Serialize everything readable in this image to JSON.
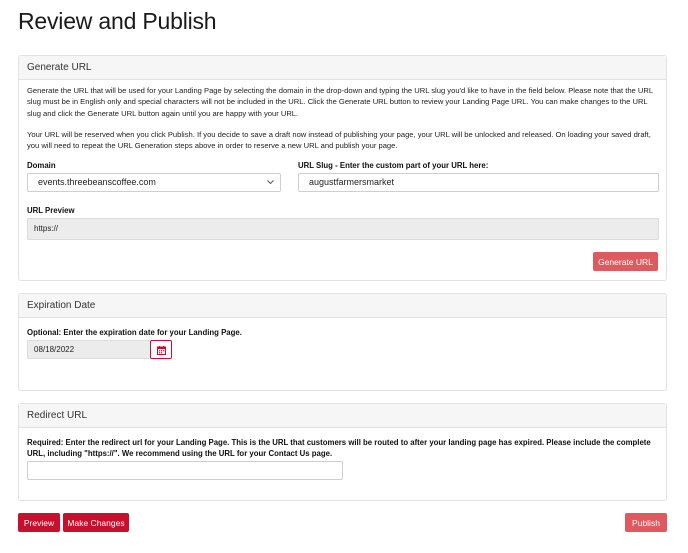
{
  "page": {
    "title": "Review and Publish"
  },
  "generate_url": {
    "header": "Generate URL",
    "description_1": "Generate the URL that will be used for your Landing Page by selecting the domain in the drop-down and typing the URL slug you'd like to have in the field below. Please note that the URL slug must be in English only and special characters will not be included in the URL. Click the Generate URL button to review your Landing Page URL. You can make changes to the URL slug and click the Generate URL button again until you are happy with your URL.",
    "description_2": "Your URL will be reserved when you click Publish. If you decide to save a draft now instead of publishing your page, your URL will be unlocked and released. On loading your saved draft, you will need to repeat the URL Generation steps above in order to reserve a new URL and publish your page.",
    "domain_label": "Domain",
    "domain_value": "events.threebeanscoffee.com",
    "slug_label": "URL Slug - Enter the custom part of your URL here:",
    "slug_value": "augustfarmersmarket",
    "preview_label": "URL Preview",
    "preview_value": "https://",
    "button": "Generate URL"
  },
  "expiration": {
    "header": "Expiration Date",
    "label": "Optional: Enter the expiration date for your Landing Page.",
    "date_value": "08/18/2022",
    "icon": "calendar-icon"
  },
  "redirect": {
    "header": "Redirect URL",
    "label": "Required: Enter the redirect url for your Landing Page. This is the URL that customers will be routed to after your landing page has expired. Please include the complete URL, including \"https://\". We recommend using the URL for your Contact Us page.",
    "value": ""
  },
  "footer": {
    "preview_button": "Preview",
    "make_changes_button": "Make Changes",
    "publish_button": "Publish"
  },
  "colors": {
    "accent": "#c8102e",
    "accent_light": "#df5a5f",
    "panel_header_bg": "#f6f6f6",
    "readonly_bg": "#ececec"
  }
}
